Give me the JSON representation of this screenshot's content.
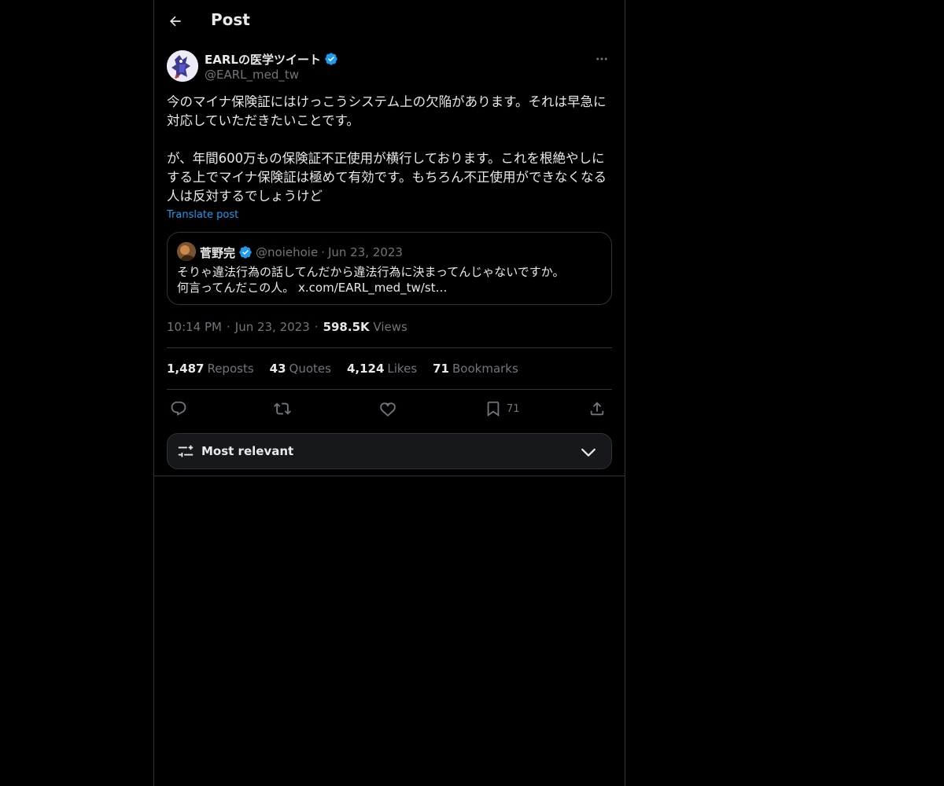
{
  "header": {
    "title": "Post",
    "back_icon": "arrow-left-icon"
  },
  "author": {
    "name": "EARLの医学ツイート",
    "handle": "@EARL_med_tw",
    "verified": true,
    "verified_color": "#1d9bf0"
  },
  "post": {
    "paragraph1": "今のマイナ保険証にはけっこうシステム上の欠陥があります。それは早急に対応していただきたいことです。",
    "paragraph2": "が、年間600万もの保険証不正使用が横行しております。これを根絶やしにする上でマイナ保険証は極めて有効です。もちろん不正使用ができなくなる人は反対するでしょうけど",
    "translate_label": "Translate post"
  },
  "quote": {
    "name": "菅野完",
    "handle": "@noiehoie",
    "separator": "·",
    "date": "Jun 23, 2023",
    "line1": "そりゃ違法行為の話してんだから違法行為に決まってんじゃないですか。",
    "line2": "何言ってんだこの人。 x.com/EARL_med_tw/st…"
  },
  "meta": {
    "time": "10:14 PM",
    "sep1": "·",
    "date": "Jun 23, 2023",
    "sep2": "·",
    "views_count": "598.5K",
    "views_label": "Views"
  },
  "stats": {
    "reposts_count": "1,487",
    "reposts_label": "Reposts",
    "quotes_count": "43",
    "quotes_label": "Quotes",
    "likes_count": "4,124",
    "likes_label": "Likes",
    "bookmarks_count": "71",
    "bookmarks_label": "Bookmarks"
  },
  "actions": {
    "reply_icon": "reply-icon",
    "repost_icon": "repost-icon",
    "like_icon": "heart-icon",
    "bookmark_icon": "bookmark-icon",
    "bookmark_count": "71",
    "share_icon": "share-icon"
  },
  "sort": {
    "label": "Most relevant",
    "icon": "sliders-icon",
    "chevron": "chevron-down-icon"
  },
  "colors": {
    "background": "#000000",
    "text": "#e7e9ea",
    "muted": "#71767b",
    "accent": "#1d9bf0",
    "border": "#2f3336"
  }
}
